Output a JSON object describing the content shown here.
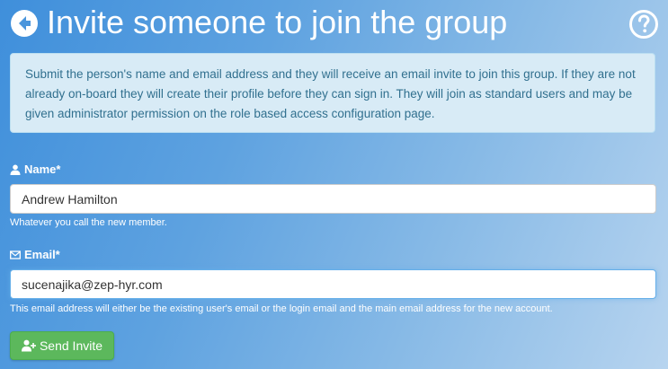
{
  "header": {
    "title": "Invite someone to join the group",
    "back_icon": "arrow-circle-left-icon",
    "help_icon": "question-circle-icon"
  },
  "info": {
    "text": "Submit the person's name and email address and they will receive an email invite to join this group. If they are not already on-board they will create their profile before they can sign in. They will join as standard users and may be given administrator permission on the role based access configuration page."
  },
  "form": {
    "name": {
      "icon": "user-icon",
      "label": "Name*",
      "value": "Andrew Hamilton",
      "help": "Whatever you call the new member."
    },
    "email": {
      "icon": "envelope-icon",
      "label": "Email*",
      "value": "sucenajika@zep-hyr.com",
      "help": "This email address will either be the existing user's email or the login email and the main email address for the new account."
    },
    "submit": {
      "icon": "user-plus-icon",
      "label": "Send Invite"
    }
  },
  "colors": {
    "info_bg": "#d8ebf6",
    "info_text": "#31708f",
    "button_green": "#5cb85c",
    "focus_blue": "#66afe9"
  }
}
